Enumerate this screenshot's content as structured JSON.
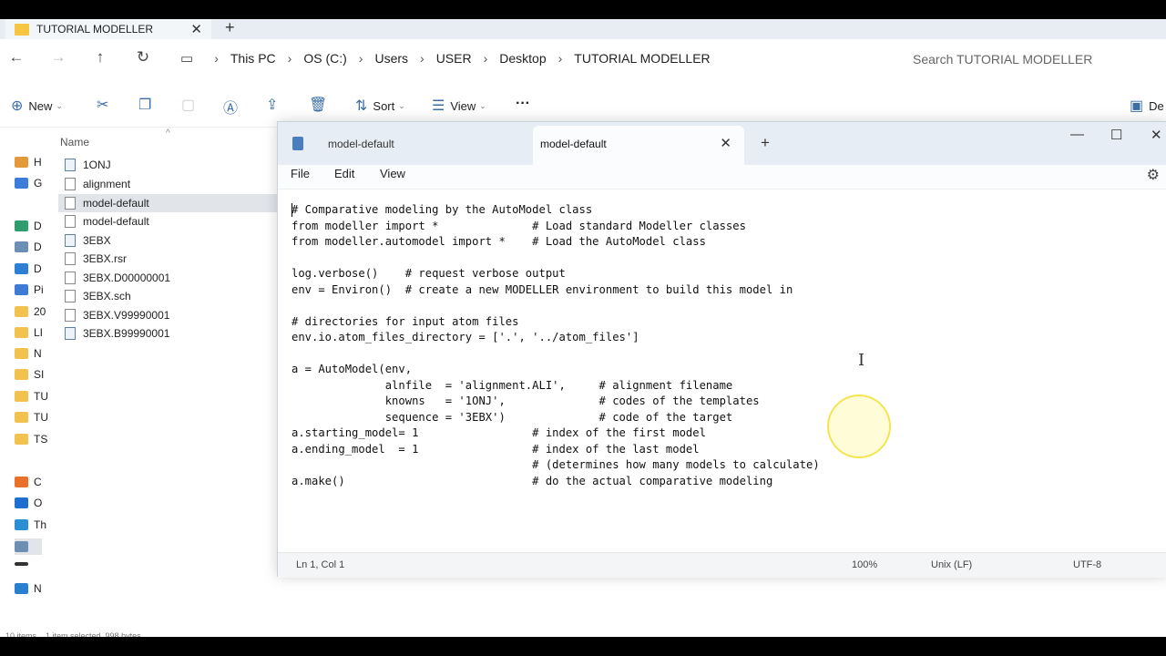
{
  "explorer": {
    "tab_title": "TUTORIAL MODELLER",
    "tab_close": "✕",
    "new_tab": "+",
    "breadcrumbs": [
      "This PC",
      "OS (C:)",
      "Users",
      "USER",
      "Desktop",
      "TUTORIAL MODELLER"
    ],
    "search_placeholder": "Search TUTORIAL MODELLER",
    "toolbar": {
      "new_label": "New",
      "sort_label": "Sort",
      "view_label": "View",
      "details_label": "De"
    },
    "nav_items": [
      "H",
      "G",
      "D",
      "D",
      "D",
      "Pi",
      "20",
      "LI",
      "N",
      "SI",
      "TU",
      "TU",
      "TS",
      "C",
      "O",
      "Th",
      "",
      "",
      "N"
    ],
    "column_name": "Name",
    "files": [
      "1ONJ",
      "alignment",
      "model-default",
      "model-default",
      "3EBX",
      "3EBX.rsr",
      "3EBX.D00000001",
      "3EBX.sch",
      "3EBX.V99990001",
      "3EBX.B99990001"
    ],
    "status_text": "10 items    1 item selected  998 bytes"
  },
  "notepad": {
    "tabs": [
      "model-default",
      "model-default"
    ],
    "tab_close": "✕",
    "new_tab": "+",
    "menu": [
      "File",
      "Edit",
      "View"
    ],
    "code_lines": [
      "# Comparative modeling by the AutoModel class",
      "from modeller import *              # Load standard Modeller classes",
      "from modeller.automodel import *    # Load the AutoModel class",
      "",
      "log.verbose()    # request verbose output",
      "env = Environ()  # create a new MODELLER environment to build this model in",
      "",
      "# directories for input atom files",
      "env.io.atom_files_directory = ['.', '../atom_files']",
      "",
      "a = AutoModel(env,",
      "              alnfile  = 'alignment.ALI',     # alignment filename",
      "              knowns   = '1ONJ',              # codes of the templates",
      "              sequence = '3EBX')              # code of the target",
      "a.starting_model= 1                 # index of the first model",
      "a.ending_model  = 1                 # index of the last model",
      "                                    # (determines how many models to calculate)",
      "a.make()                            # do the actual comparative modeling"
    ],
    "status": {
      "position": "Ln 1, Col 1",
      "zoom": "100%",
      "line_ending": "Unix (LF)",
      "encoding": "UTF-8"
    }
  }
}
